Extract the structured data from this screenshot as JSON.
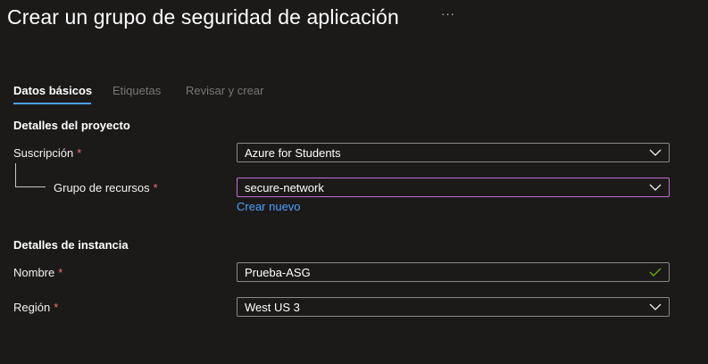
{
  "header": {
    "title": "Crear un grupo de seguridad de aplicación",
    "more_label": "···"
  },
  "tabs": [
    {
      "label": "Datos básicos",
      "active": true
    },
    {
      "label": "Etiquetas",
      "active": false
    },
    {
      "label": "Revisar y crear",
      "active": false
    }
  ],
  "project": {
    "heading": "Detalles del proyecto",
    "subscription": {
      "label": "Suscripción",
      "required": "*",
      "value": "Azure for Students"
    },
    "resource_group": {
      "label": "Grupo de recursos",
      "required": "*",
      "value": "secure-network",
      "create_new": "Crear nuevo"
    }
  },
  "instance": {
    "heading": "Detalles de instancia",
    "name": {
      "label": "Nombre",
      "required": "*",
      "value": "Prueba-ASG"
    },
    "region": {
      "label": "Región",
      "required": "*",
      "value": "West US 3"
    }
  },
  "colors": {
    "background": "#1b1a19",
    "accent": "#4ea1ff",
    "required": "#f1707b",
    "focus_border": "#c66cd6",
    "valid_check": "#6bb700"
  },
  "icons": {
    "dropdown": "chevron-down-icon",
    "valid": "checkmark-icon"
  }
}
